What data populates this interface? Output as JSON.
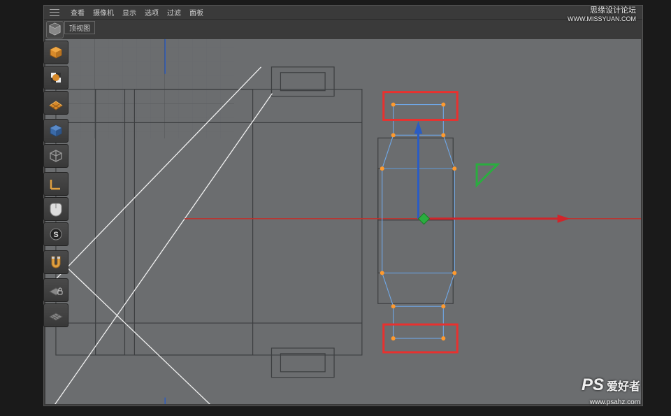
{
  "menus": {
    "m1": "查看",
    "m2": "摄像机",
    "m3": "显示",
    "m4": "选项",
    "m5": "过滤",
    "m6": "面板"
  },
  "viewlabel": "顶视图",
  "watermark": {
    "title": "思缘设计论坛",
    "url1": "WWW.MISSYUAN.COM",
    "brand": "爱好者",
    "suburl": "www.psahz.com"
  },
  "colors": {
    "red": "#e8312f",
    "blue": "#4a90d9",
    "green": "#2aad3f",
    "orange": "#ff9a2e",
    "white": "#f0f0f0",
    "dark": "#3a3c3e",
    "axis_x": "#d0252a",
    "axis_y": "#2a5cc4"
  }
}
